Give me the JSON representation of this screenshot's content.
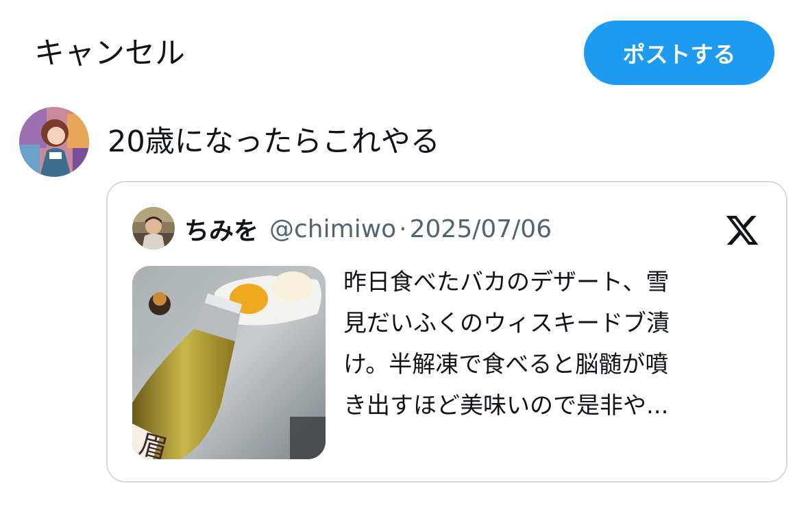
{
  "header": {
    "cancel_label": "キャンセル",
    "post_label": "ポストする"
  },
  "composer": {
    "text": "20歳になったらこれやる"
  },
  "quote": {
    "name": "ちみを",
    "handle": "@chimiwo",
    "separator": "·",
    "date": "2025/07/06",
    "text_lines": [
      "昨日食べたバカのデザート、雪",
      "見だいふくのウィスキードブ漬",
      "け。半解凍で食べると脳髄が噴",
      "き出すほど美味いので是非や..."
    ]
  },
  "colors": {
    "accent": "#1d9bf0",
    "text_primary": "#0f1419",
    "text_secondary": "#536471",
    "border": "#cfd9de"
  },
  "icons": {
    "platform_logo": "x-logo-icon"
  }
}
